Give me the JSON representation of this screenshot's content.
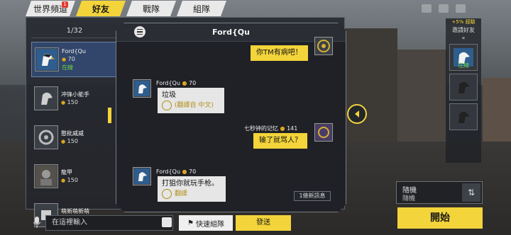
{
  "tabs": [
    {
      "label": "世界頻道",
      "badge": "1",
      "active": false
    },
    {
      "label": "好友",
      "active": true
    },
    {
      "label": "戰隊",
      "active": false
    },
    {
      "label": "組隊",
      "active": false
    }
  ],
  "friend_list": {
    "counter": "1/32",
    "items": [
      {
        "name": "Ford{Qu",
        "level": "70",
        "status": "在線",
        "selected": true
      },
      {
        "name": "冲锋小能手",
        "level": "150",
        "status": "",
        "selected": false
      },
      {
        "name": "憨批威威",
        "level": "150",
        "status": "",
        "selected": false
      },
      {
        "name": "龍甲",
        "level": "150",
        "status": "",
        "selected": false
      },
      {
        "name": "萌新萌新萌",
        "level": "150",
        "status": "",
        "selected": false
      }
    ]
  },
  "chat": {
    "title": "Ford{Qu",
    "messages": [
      {
        "side": "right",
        "text": "你TM有病吧！"
      },
      {
        "side": "left",
        "sender": "Ford{Qu",
        "level": "70",
        "text": "垃圾",
        "translate": "(翻譯自 中文)"
      },
      {
        "side": "right",
        "sender": "七秒钟的记忆",
        "level": "141",
        "text": "输了就骂人？"
      },
      {
        "side": "left",
        "sender": "Ford{Qu",
        "level": "70",
        "text": "打狙你就玩手枪。",
        "translate": "翻譯"
      }
    ],
    "new_messages": "1條新訊息"
  },
  "input": {
    "placeholder": "在這裡輸入",
    "quick_team": "快速組隊",
    "send": "發送"
  },
  "right_panel": {
    "bonus": "+5% 經驗",
    "invite_title": "邀請好友",
    "invite_arrows": "«",
    "slot_status": "在線",
    "mode_line1": "隨機",
    "mode_line2": "隨機",
    "start": "開始"
  },
  "colors": {
    "accent": "#f3d43a",
    "online": "#6cd14a",
    "panel": "#23262b"
  }
}
